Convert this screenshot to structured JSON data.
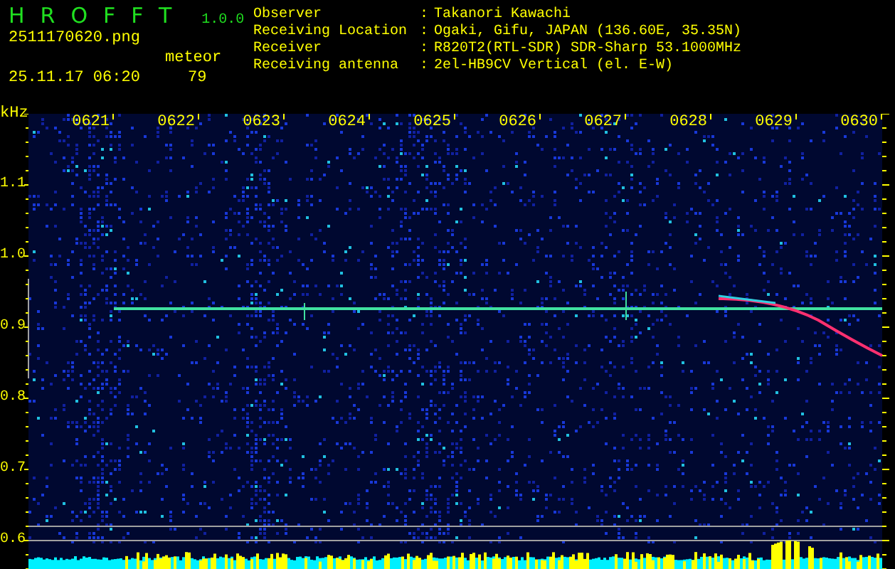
{
  "app": {
    "name": "HROFFT",
    "version": "1.0.0"
  },
  "file": {
    "name": "2511170620.png",
    "datetime": "25.11.17 06:20"
  },
  "detection": {
    "label": "meteor",
    "count": "79"
  },
  "station": [
    {
      "label": "Observer",
      "separator": ":",
      "value": "Takanori Kawachi"
    },
    {
      "label": "Receiving Location",
      "separator": ":",
      "value": "Ogaki, Gifu, JAPAN (136.60E, 35.35N)"
    },
    {
      "label": "Receiver",
      "separator": ":",
      "value": "R820T2(RTL-SDR) SDR-Sharp 53.1000MHz"
    },
    {
      "label": "Receiving antenna",
      "separator": ":",
      "value": "2el-HB9CV Vertical (el. E-W)"
    }
  ],
  "spectrogram": {
    "frequency_unit": "kHz",
    "time_labels": [
      "0621",
      "0622",
      "0623",
      "0624",
      "0625",
      "0626",
      "0627",
      "0628",
      "0629",
      "0630"
    ],
    "frequency_labels": [
      "1.1",
      "1.0",
      "0.9",
      "0.8",
      "0.7",
      "0.6"
    ]
  }
}
